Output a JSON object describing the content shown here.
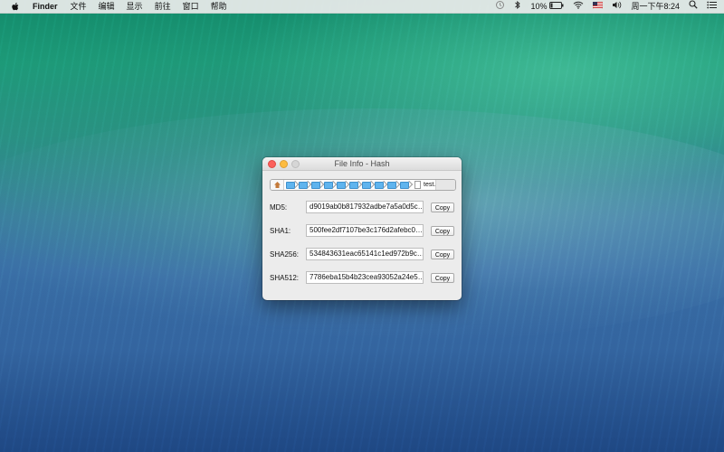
{
  "menubar": {
    "app_name": "Finder",
    "items": [
      "文件",
      "编辑",
      "显示",
      "前往",
      "窗口",
      "帮助"
    ],
    "battery_percent": "10%",
    "clock": "周一下午8:24"
  },
  "window": {
    "title": "File Info - Hash",
    "path": {
      "file_name": "test.",
      "folder_count": 10
    },
    "hashes": [
      {
        "label": "MD5:",
        "value": "d9019ab0b817932adbe7a5a0d5c…",
        "button": "Copy"
      },
      {
        "label": "SHA1:",
        "value": "500fee2df7107be3c176d2afebc0…",
        "button": "Copy"
      },
      {
        "label": "SHA256:",
        "value": "534843631eac65141c1ed972b9c…",
        "button": "Copy"
      },
      {
        "label": "SHA512:",
        "value": "7786eba15b4b23cea93052a24e5…",
        "button": "Copy"
      }
    ]
  },
  "colors": {
    "close": "#fc605c",
    "minimize": "#fdbc40",
    "folder": "#5fb4ee"
  }
}
